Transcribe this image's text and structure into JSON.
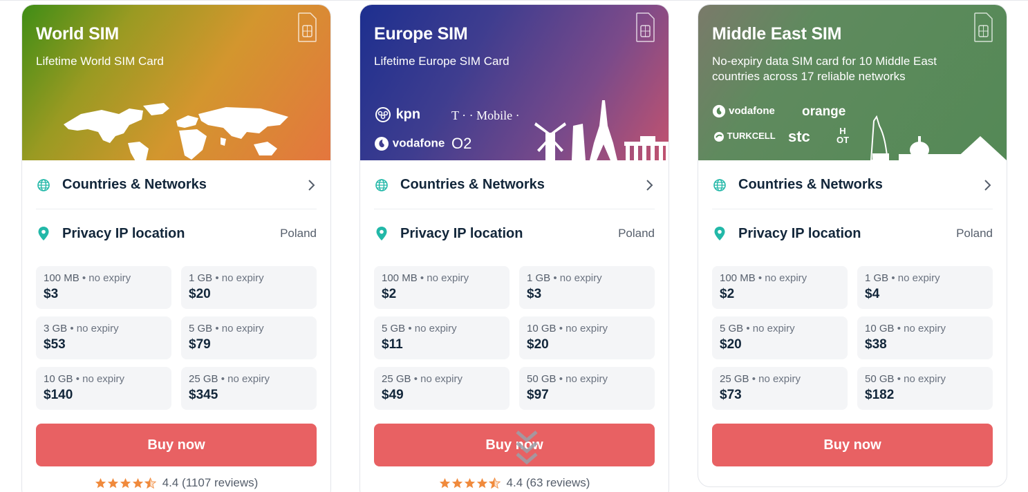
{
  "colors": {
    "accent": "#e86163",
    "teal": "#22b8a8",
    "star": "#f08a3c",
    "text": "#12263a"
  },
  "cards": [
    {
      "title": "World SIM",
      "subtitle": "Lifetime World SIM Card",
      "countries_label": "Countries & Networks",
      "privacy_label": "Privacy IP location",
      "privacy_value": "Poland",
      "plans": [
        {
          "size": "100 MB",
          "expiry": " • no expiry",
          "price": "$3"
        },
        {
          "size": "1 GB",
          "expiry": " • no expiry",
          "price": "$20"
        },
        {
          "size": "3 GB",
          "expiry": " • no expiry",
          "price": "$53"
        },
        {
          "size": "5 GB",
          "expiry": " • no expiry",
          "price": "$79"
        },
        {
          "size": "10 GB",
          "expiry": " • no expiry",
          "price": "$140"
        },
        {
          "size": "25 GB",
          "expiry": " • no expiry",
          "price": "$345"
        }
      ],
      "buy_label": "Buy now",
      "rating_text": "4.4 (1107 reviews)"
    },
    {
      "title": "Europe SIM",
      "subtitle": "Lifetime Europe SIM Card",
      "logos": [
        "kpn",
        "T · · Mobile ·",
        "vodafone",
        "O2"
      ],
      "countries_label": "Countries & Networks",
      "privacy_label": "Privacy IP location",
      "privacy_value": "Poland",
      "plans": [
        {
          "size": "100 MB",
          "expiry": " • no expiry",
          "price": "$2"
        },
        {
          "size": "1 GB",
          "expiry": " • no expiry",
          "price": "$3"
        },
        {
          "size": "5 GB",
          "expiry": " • no expiry",
          "price": "$11"
        },
        {
          "size": "10 GB",
          "expiry": " • no expiry",
          "price": "$20"
        },
        {
          "size": "25 GB",
          "expiry": " • no expiry",
          "price": "$49"
        },
        {
          "size": "50 GB",
          "expiry": " • no expiry",
          "price": "$97"
        }
      ],
      "buy_label": "Buy now",
      "rating_text": "4.4 (63 reviews)"
    },
    {
      "title": "Middle East SIM",
      "subtitle": "No-expiry data SIM card for 10 Middle East countries across 17 reliable networks",
      "logos": [
        "vodafone",
        "orange",
        "TURKCELL",
        "stc",
        "H OT"
      ],
      "countries_label": "Countries & Networks",
      "privacy_label": "Privacy IP location",
      "privacy_value": "Poland",
      "plans": [
        {
          "size": "100 MB",
          "expiry": " • no expiry",
          "price": "$2"
        },
        {
          "size": "1 GB",
          "expiry": " • no expiry",
          "price": "$4"
        },
        {
          "size": "5 GB",
          "expiry": " • no expiry",
          "price": "$20"
        },
        {
          "size": "10 GB",
          "expiry": " • no expiry",
          "price": "$38"
        },
        {
          "size": "25 GB",
          "expiry": " • no expiry",
          "price": "$73"
        },
        {
          "size": "50 GB",
          "expiry": " • no expiry",
          "price": "$182"
        }
      ],
      "buy_label": "Buy now"
    }
  ],
  "icons": [
    "sim-card-icon",
    "globe-icon",
    "location-pin-icon",
    "chevron-right-icon",
    "star-icon",
    "scroll-down-icon"
  ]
}
